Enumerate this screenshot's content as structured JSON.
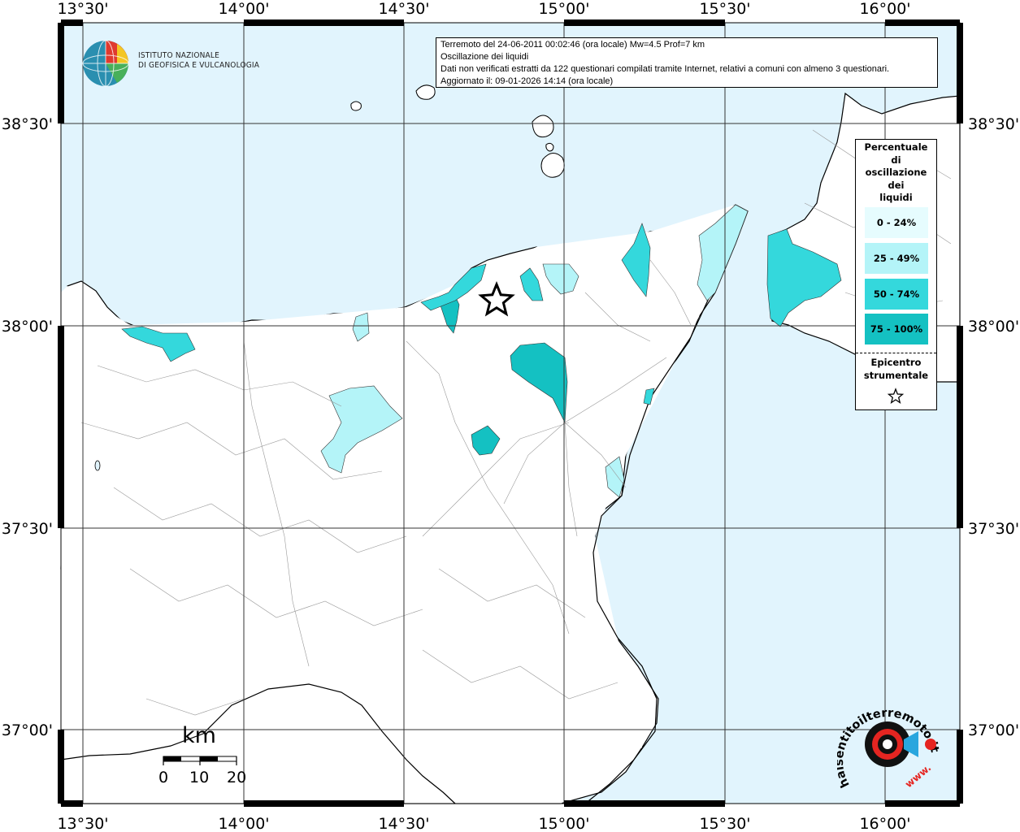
{
  "map": {
    "lon_labels": [
      "13°30'",
      "14°00'",
      "14°30'",
      "15°00'",
      "15°30'",
      "16°00'"
    ],
    "lat_labels": [
      "38°30'",
      "38°00'",
      "37°30'",
      "37°00'"
    ],
    "colors": {
      "sea": "#e1f4fd",
      "land": "#ffffff",
      "class_0_24": "#e6fcfe",
      "class_25_49": "#b4f4f8",
      "class_50_74": "#34d8dc",
      "class_75_100": "#14c1c2"
    }
  },
  "info": {
    "line1": "Terremoto del 24-06-2011 00:02:46 (ora locale) Mw=4.5 Prof=7 km",
    "line2": "Oscillazione dei liquidi",
    "line3": "Dati non verificati estratti da 122 questionari compilati tramite Internet, relativi a comuni con almeno 3 questionari.",
    "line4": "Aggiornato il: 09-01-2026 14:14 (ora locale)"
  },
  "legend": {
    "title_lines": [
      "Percentuale",
      "di",
      "oscillazione",
      "dei",
      "liquidi"
    ],
    "classes": [
      "0 - 24%",
      "25 - 49%",
      "50 - 74%",
      "75 - 100%"
    ],
    "epicenter_lines": [
      "Epicentro",
      "strumentale"
    ]
  },
  "logo_ingv": {
    "line1": "ISTITUTO NAZIONALE",
    "line2": "DI GEOFISICA E VULCANOLOGIA"
  },
  "scale": {
    "title": "km",
    "labels": [
      "0",
      "10",
      "20"
    ]
  },
  "logo_hst": {
    "text": "haisentitoilterremoto.it",
    "url_text": "www."
  }
}
